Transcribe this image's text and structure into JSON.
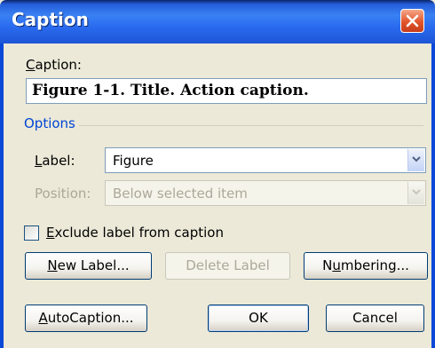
{
  "window": {
    "title": "Caption"
  },
  "caption": {
    "label_pre": "",
    "label_accel": "C",
    "label_post": "aption:",
    "value": "Figure 1-1. Title. Action caption."
  },
  "options": {
    "group_label": "Options",
    "label_field": {
      "label_pre": "",
      "label_accel": "L",
      "label_post": "abel:",
      "value": "Figure"
    },
    "position_field": {
      "label": "Position:",
      "value": "Below selected item"
    }
  },
  "exclude_checkbox": {
    "label_pre": "",
    "label_accel": "E",
    "label_post": "xclude label from caption",
    "checked": false
  },
  "buttons": {
    "new_label": {
      "pre": "",
      "accel": "N",
      "post": "ew Label..."
    },
    "delete_label": {
      "label": "Delete Label"
    },
    "numbering": {
      "pre": "N",
      "accel": "u",
      "post": "mbering..."
    },
    "autocaption": {
      "pre": "",
      "accel": "A",
      "post": "utoCaption..."
    },
    "ok": {
      "label": "OK"
    },
    "cancel": {
      "label": "Cancel"
    }
  },
  "colors": {
    "titlebar": "#2b6cf0",
    "dialog_bg": "#ece9d8",
    "group_label": "#0046d5",
    "disabled_text": "#aca899",
    "close_button": "#e2552b"
  }
}
